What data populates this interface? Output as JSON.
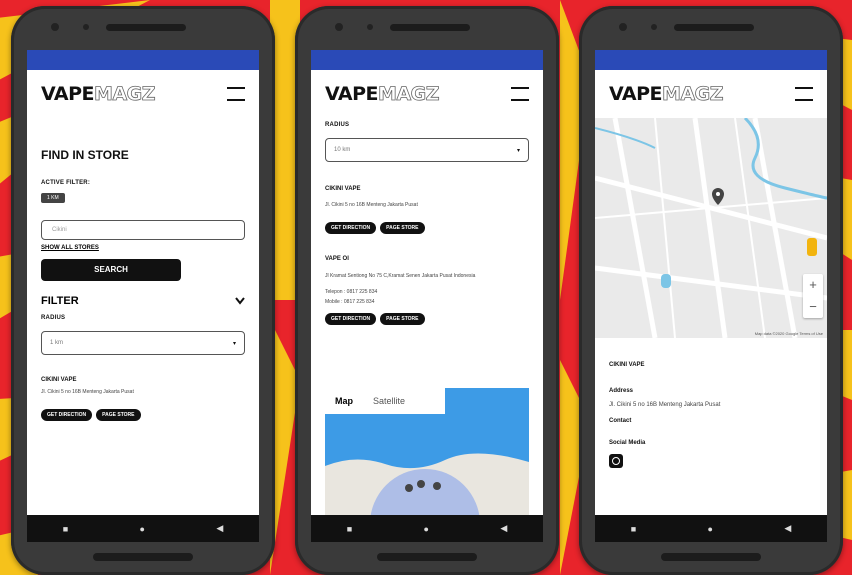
{
  "colors": {
    "brand": "#111111",
    "status_bar": "#2a4ab7",
    "background_red": "#e8242b",
    "background_yellow": "#f6c21b"
  },
  "logo": {
    "bold": "VAPE",
    "outline": "MAGZ",
    "tiny": "INDONESIA"
  },
  "icons": {
    "menu": "hamburger-icon",
    "chevron": "chevron-down-icon",
    "pin": "map-pin-icon",
    "instagram": "instagram-icon"
  },
  "phone1": {
    "title": "FIND IN STORE",
    "active_filter_label": "ACTIVE FILTER:",
    "active_filter_chip": "1 KM",
    "search_placeholder": "Cikini",
    "show_all": "SHOW ALL STORES",
    "search_button": "SEARCH",
    "filter_title": "FILTER",
    "radius_label": "RADIUS",
    "radius_value": "1 km",
    "store": {
      "name": "CIKINI VAPE",
      "address": "Jl. Cikini 5 no 16B Menteng Jakarta Pusat",
      "direction": "GET DIRECTION",
      "page": "PAGE STORE"
    }
  },
  "phone2": {
    "radius_label": "RADIUS",
    "radius_value": "10 km",
    "stores": [
      {
        "name": "CIKINI VAPE",
        "address": "Jl. Cikini 5 no 16B Menteng Jakarta Pusat",
        "direction": "GET DIRECTION",
        "page": "PAGE STORE"
      },
      {
        "name": "VAPE OI",
        "address": "Jl Kramat Sentiong No 75 C,Kramat Senen Jakarta Pusat Indonesia",
        "phone": "Telepon : 0817 225 834",
        "mobile": "Mobile : 0817 225 834",
        "direction": "GET DIRECTION",
        "page": "PAGE STORE"
      }
    ],
    "map_tabs": [
      "Map",
      "Satellite"
    ]
  },
  "phone3": {
    "map_footer": "Map data ©2020 Google   Terms of Use",
    "store_name": "CIKINI VAPE",
    "address_label": "Address",
    "address": "Jl. Cikini 5 no 16B Menteng Jakarta Pusat",
    "contact_label": "Contact",
    "social_label": "Social Media"
  },
  "nav": {
    "recent": "■",
    "home": "●",
    "back": "◀"
  }
}
